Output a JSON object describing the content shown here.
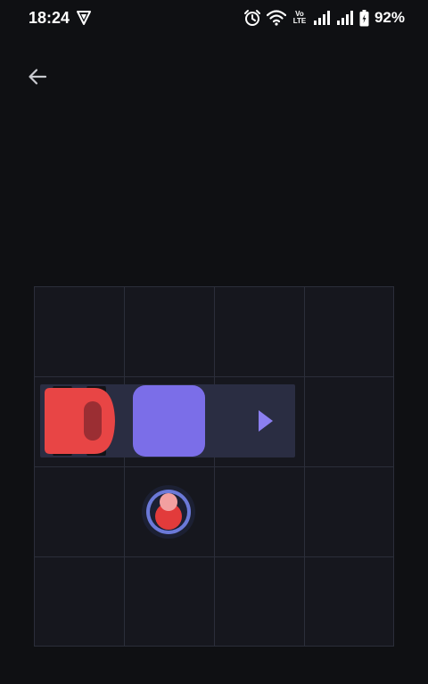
{
  "status_bar": {
    "time": "18:24",
    "battery_percent": "92%",
    "volte_top": "Vo",
    "volte_bottom": "LTE",
    "icons": [
      "vpn-icon",
      "alarm-icon",
      "wifi-icon",
      "signal-icon",
      "signal-icon",
      "battery-icon"
    ]
  },
  "navigation": {
    "back_icon": "arrow-left-icon"
  },
  "board": {
    "rows": 4,
    "columns": 4,
    "colors": {
      "background": "#0f1013",
      "board": "#16171e",
      "grid_line": "#2b2e3a",
      "track": "#2a2d42",
      "car": "#e84545",
      "block": "#7b6ee8",
      "arrow": "#8b7ff0",
      "passenger_ring": "#6b79d8",
      "passenger_head": "#f2a0a0",
      "passenger_body": "#e23b3b"
    },
    "pieces": [
      {
        "type": "car",
        "row": 2,
        "col": 1,
        "facing": "right",
        "color": "red"
      },
      {
        "type": "block",
        "row": 2,
        "col": 2,
        "color": "purple"
      },
      {
        "type": "direction-arrow",
        "row": 2,
        "col": 3,
        "direction": "right"
      },
      {
        "type": "passenger",
        "row": 3,
        "col": 2,
        "color": "red"
      }
    ]
  }
}
